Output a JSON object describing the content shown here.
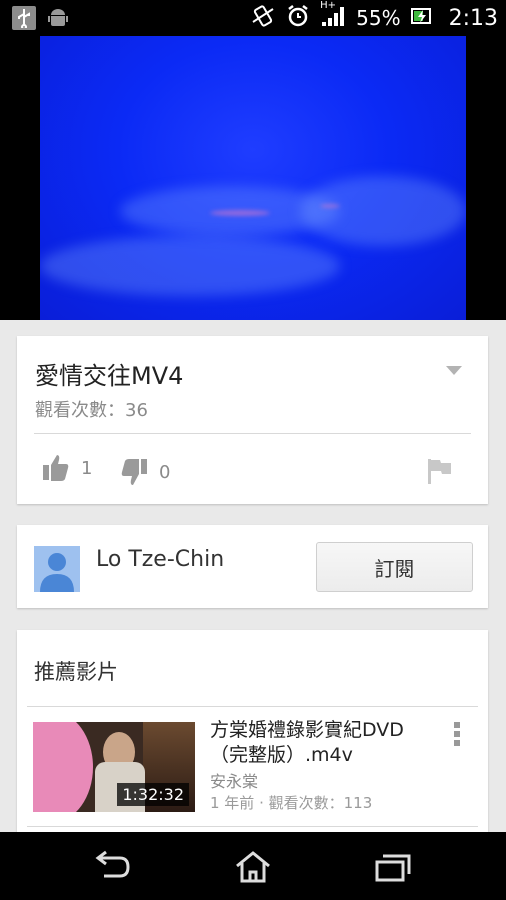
{
  "status_bar": {
    "battery": "55%",
    "time": "2:13",
    "network": "H+"
  },
  "video": {
    "title": "愛情交往MV4",
    "views": "觀看次數：36",
    "likes": "1",
    "dislikes": "0"
  },
  "channel": {
    "name": "Lo Tze-Chin",
    "subscribe_label": "訂閱"
  },
  "recommended": {
    "section_title": "推薦影片",
    "items": [
      {
        "title": "方棠婚禮錄影實紀DVD（完整版）.m4v",
        "author": "安永棠",
        "meta": "1 年前 · 觀看次數：113",
        "duration": "1:32:32"
      }
    ]
  },
  "colors": {
    "video_blue": "#0b2af5",
    "card_bg": "#ffffff",
    "page_bg": "#e9e9e9"
  }
}
